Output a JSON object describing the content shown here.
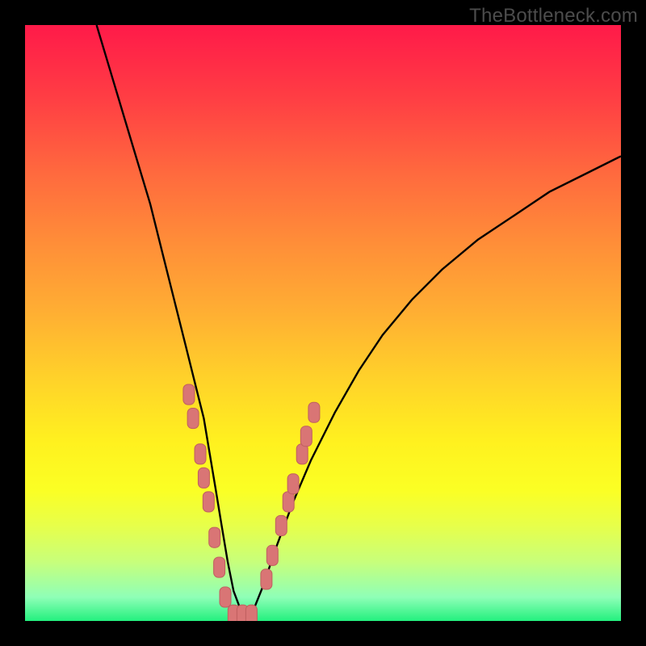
{
  "watermark": "TheBottleneck.com",
  "colors": {
    "frame": "#000000",
    "curve": "#000000",
    "marker_fill": "#d97575",
    "marker_stroke": "#bf5f5f"
  },
  "chart_data": {
    "type": "line",
    "title": "",
    "xlabel": "",
    "ylabel": "",
    "xlim": [
      0,
      100
    ],
    "ylim": [
      0,
      100
    ],
    "grid": false,
    "legend": false,
    "annotations": [],
    "series": [
      {
        "name": "bottleneck-curve",
        "x": [
          12,
          15,
          18,
          21,
          23,
          25,
          27,
          28.5,
          30,
          31,
          32,
          33,
          34,
          35,
          36.5,
          38,
          40,
          42,
          45,
          48,
          52,
          56,
          60,
          65,
          70,
          76,
          82,
          88,
          94,
          100
        ],
        "values": [
          100,
          90,
          80,
          70,
          62,
          54,
          46,
          40,
          34,
          28,
          22,
          16,
          10,
          5,
          1,
          1,
          6,
          12,
          20,
          27,
          35,
          42,
          48,
          54,
          59,
          64,
          68,
          72,
          75,
          78
        ]
      }
    ],
    "markers": [
      {
        "x": 27.5,
        "y": 38
      },
      {
        "x": 28.2,
        "y": 34
      },
      {
        "x": 29.4,
        "y": 28
      },
      {
        "x": 30.0,
        "y": 24
      },
      {
        "x": 30.8,
        "y": 20
      },
      {
        "x": 31.8,
        "y": 14
      },
      {
        "x": 32.6,
        "y": 9
      },
      {
        "x": 33.6,
        "y": 4
      },
      {
        "x": 35.0,
        "y": 1
      },
      {
        "x": 36.5,
        "y": 1
      },
      {
        "x": 38.0,
        "y": 1
      },
      {
        "x": 40.5,
        "y": 7
      },
      {
        "x": 41.5,
        "y": 11
      },
      {
        "x": 43.0,
        "y": 16
      },
      {
        "x": 44.2,
        "y": 20
      },
      {
        "x": 45.0,
        "y": 23
      },
      {
        "x": 46.5,
        "y": 28
      },
      {
        "x": 47.2,
        "y": 31
      },
      {
        "x": 48.5,
        "y": 35
      }
    ],
    "marker_style": {
      "shape": "rounded-rect",
      "width_pct": 1.9,
      "height_pct": 3.4,
      "rx": 6
    }
  }
}
